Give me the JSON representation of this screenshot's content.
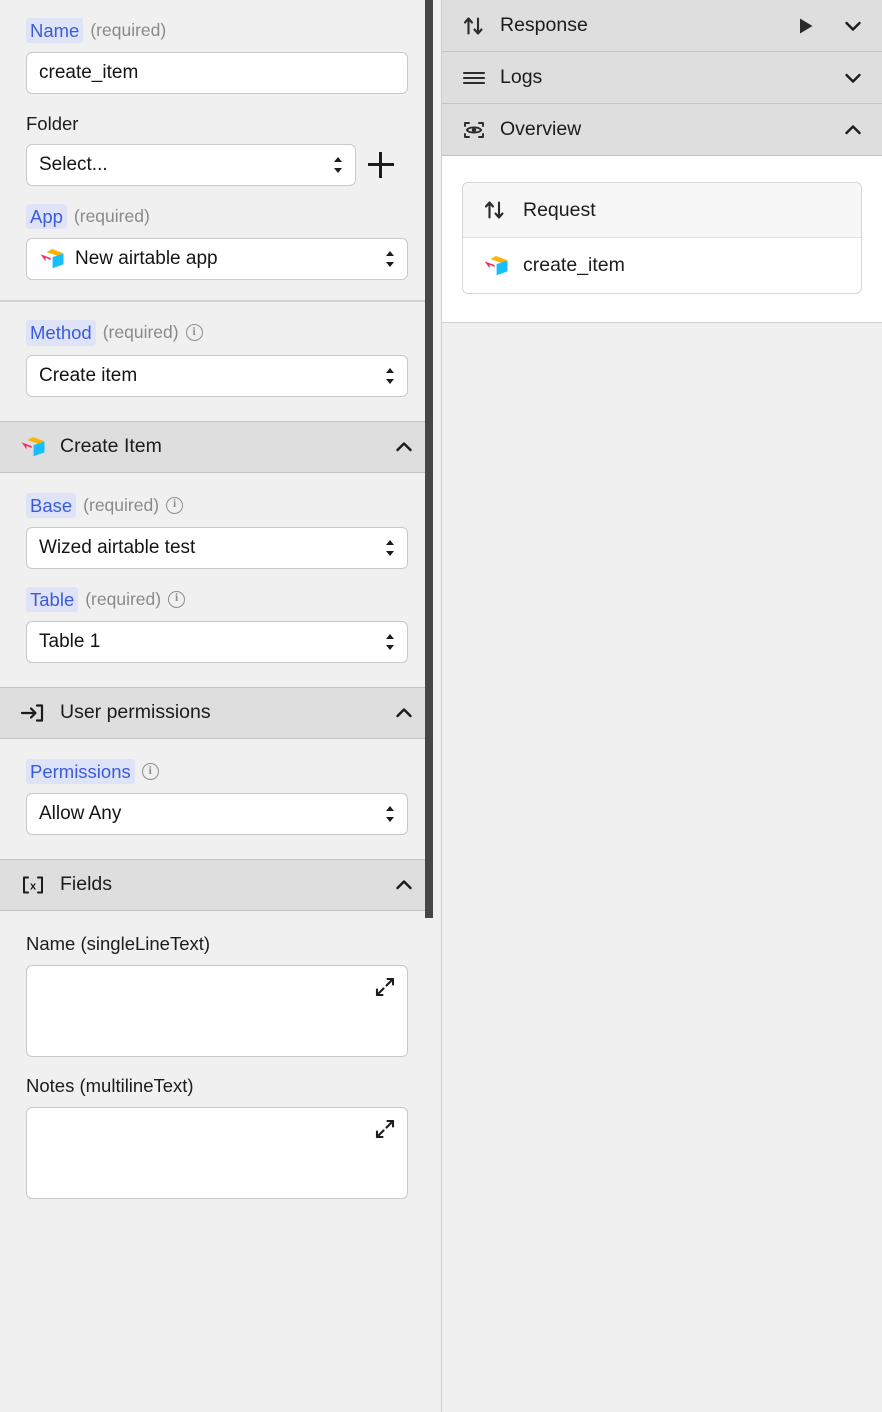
{
  "left": {
    "general": {
      "name": {
        "label": "Name",
        "required": "(required)",
        "value": "create_item"
      },
      "folder": {
        "label": "Folder",
        "value": "Select...",
        "add_button": "+"
      },
      "app": {
        "label": "App",
        "required": "(required)",
        "value": "New airtable app",
        "icon": "airtable-icon"
      }
    },
    "method": {
      "label": "Method",
      "required": "(required)",
      "info": "i",
      "value": "Create item"
    },
    "sections": {
      "create_item": {
        "title": "Create Item",
        "icon": "airtable-icon",
        "caret": "chevron-up-icon",
        "base": {
          "label": "Base",
          "required": "(required)",
          "info": "i",
          "value": "Wized airtable test"
        },
        "table": {
          "label": "Table",
          "required": "(required)",
          "info": "i",
          "value": "Table 1"
        }
      },
      "user_permissions": {
        "title": "User permissions",
        "icon": "login-arrow-icon",
        "caret": "chevron-up-icon",
        "permissions": {
          "label": "Permissions",
          "info": "i",
          "value": "Allow Any"
        }
      },
      "fields": {
        "title": "Fields",
        "icon": "variable-brackets-icon",
        "caret": "chevron-up-icon",
        "items": [
          {
            "label": "Name (singleLineText)",
            "value": "",
            "expand": "expand-icon"
          },
          {
            "label": "Notes (multilineText)",
            "value": "",
            "expand": "expand-icon"
          }
        ]
      }
    }
  },
  "right": {
    "headers": [
      {
        "title": "Response",
        "icon": "updown-arrows-icon",
        "caret": "chevron-down-icon",
        "run": "play-icon"
      },
      {
        "title": "Logs",
        "icon": "hamburger-lines-icon",
        "caret": "chevron-down-icon"
      },
      {
        "title": "Overview",
        "icon": "eye-scan-icon",
        "caret": "chevron-up-icon"
      }
    ],
    "overview": {
      "rows": [
        {
          "label": "Request",
          "icon": "updown-arrows-icon"
        },
        {
          "label": "create_item",
          "icon": "airtable-icon"
        }
      ]
    }
  },
  "colors": {
    "accent": "#3b5bdb",
    "tag_bg": "#dfe3f7",
    "section_header_bg": "#dedede",
    "panel_bg": "#f0f0f0",
    "scrollbar": "#464646"
  }
}
